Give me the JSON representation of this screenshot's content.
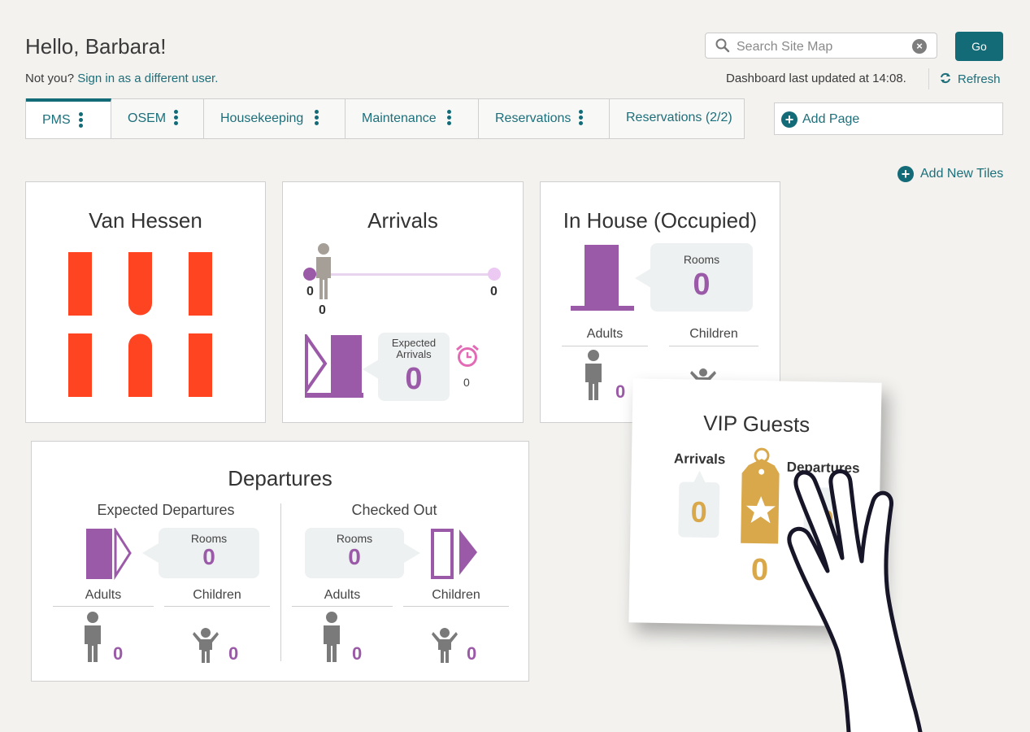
{
  "header": {
    "greeting": "Hello, Barbara!",
    "not_you": "Not you?",
    "sign_in_link": "Sign in as a different user.",
    "search_placeholder": "Search Site Map",
    "go_label": "Go",
    "last_updated": "Dashboard last updated at 14:08.",
    "refresh_label": "Refresh"
  },
  "tabs": [
    {
      "label": "PMS",
      "active": true
    },
    {
      "label": "OSEM"
    },
    {
      "label": "Housekeeping"
    },
    {
      "label": "Maintenance"
    },
    {
      "label": "Reservations"
    },
    {
      "label": "Reservations (2/2)"
    }
  ],
  "add_page_label": "Add Page",
  "add_tiles_label": "Add New Tiles",
  "tiles": {
    "van_hessen": {
      "title": "Van Hessen",
      "logo_color": "#ff4422"
    },
    "arrivals": {
      "title": "Arrivals",
      "slider_start": "0",
      "slider_end": "0",
      "person_count": "0",
      "expected_label": "Expected Arrivals",
      "expected_value": "0",
      "alarm_count": "0"
    },
    "in_house": {
      "title": "In House (Occupied)",
      "rooms_label": "Rooms",
      "rooms_value": "0",
      "adults_label": "Adults",
      "children_label": "Children",
      "adults_value": "0"
    },
    "departures": {
      "title": "Departures",
      "expected": {
        "heading": "Expected Departures",
        "rooms_label": "Rooms",
        "rooms_value": "0",
        "adults_label": "Adults",
        "children_label": "Children",
        "adults_value": "0",
        "children_value": "0"
      },
      "checked_out": {
        "heading": "Checked Out",
        "rooms_label": "Rooms",
        "rooms_value": "0",
        "adults_label": "Adults",
        "children_label": "Children",
        "adults_value": "0",
        "children_value": "0"
      }
    },
    "vip": {
      "title": "VIP Guests",
      "arrivals_label": "Arrivals",
      "departures_label": "Departures",
      "arrivals_value": "0",
      "total_value": "0"
    }
  },
  "colors": {
    "accent": "#136b77",
    "purple": "#9b5aa8",
    "gold": "#d9a84a",
    "grey_icon": "#7a7a7a"
  }
}
